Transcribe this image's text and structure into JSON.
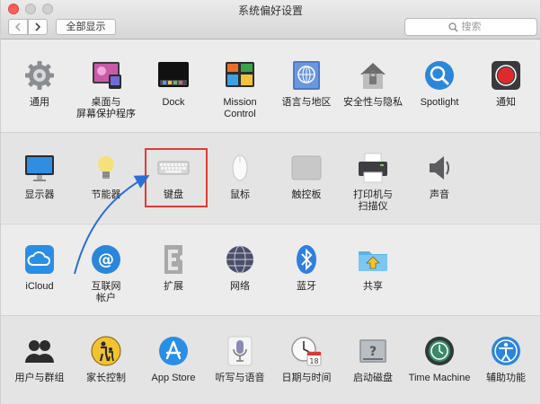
{
  "window": {
    "title": "系统偏好设置",
    "show_all_label": "全部显示",
    "search_placeholder": "搜索"
  },
  "sections": [
    {
      "items": [
        {
          "label": "通用",
          "icon": "gear-icon"
        },
        {
          "label": "桌面与\n屏幕保护程序",
          "icon": "desktop-screensaver-icon"
        },
        {
          "label": "Dock",
          "icon": "dock-icon"
        },
        {
          "label": "Mission\nControl",
          "icon": "mission-control-icon"
        },
        {
          "label": "语言与地区",
          "icon": "language-region-icon"
        },
        {
          "label": "安全性与隐私",
          "icon": "security-house-icon"
        },
        {
          "label": "Spotlight",
          "icon": "spotlight-magnifier-icon"
        },
        {
          "label": "通知",
          "icon": "notifications-icon"
        }
      ]
    },
    {
      "items": [
        {
          "label": "显示器",
          "icon": "display-icon"
        },
        {
          "label": "节能器",
          "icon": "lightbulb-icon"
        },
        {
          "label": "键盘",
          "icon": "keyboard-icon"
        },
        {
          "label": "鼠标",
          "icon": "mouse-icon"
        },
        {
          "label": "触控板",
          "icon": "trackpad-icon"
        },
        {
          "label": "打印机与\n扫描仪",
          "icon": "printer-icon"
        },
        {
          "label": "声音",
          "icon": "speaker-icon"
        }
      ]
    },
    {
      "items": [
        {
          "label": "iCloud",
          "icon": "icloud-icon"
        },
        {
          "label": "互联网\n帐户",
          "icon": "internet-accounts-at-icon"
        },
        {
          "label": "扩展",
          "icon": "extensions-icon"
        },
        {
          "label": "网络",
          "icon": "network-globe-icon"
        },
        {
          "label": "蓝牙",
          "icon": "bluetooth-icon"
        },
        {
          "label": "共享",
          "icon": "sharing-folder-icon"
        }
      ]
    },
    {
      "items": [
        {
          "label": "用户与群组",
          "icon": "users-groups-icon"
        },
        {
          "label": "家长控制",
          "icon": "parental-controls-icon"
        },
        {
          "label": "App Store",
          "icon": "app-store-icon"
        },
        {
          "label": "听写与语音",
          "icon": "microphone-icon"
        },
        {
          "label": "日期与时间",
          "icon": "clock-calendar-icon"
        },
        {
          "label": "启动磁盘",
          "icon": "startup-disk-icon"
        },
        {
          "label": "Time Machine",
          "icon": "time-machine-icon"
        },
        {
          "label": "辅助功能",
          "icon": "accessibility-icon"
        }
      ]
    }
  ],
  "calendar_date": "18",
  "colors": {
    "highlight": "#e53935",
    "arrow": "#2a6ed8"
  }
}
